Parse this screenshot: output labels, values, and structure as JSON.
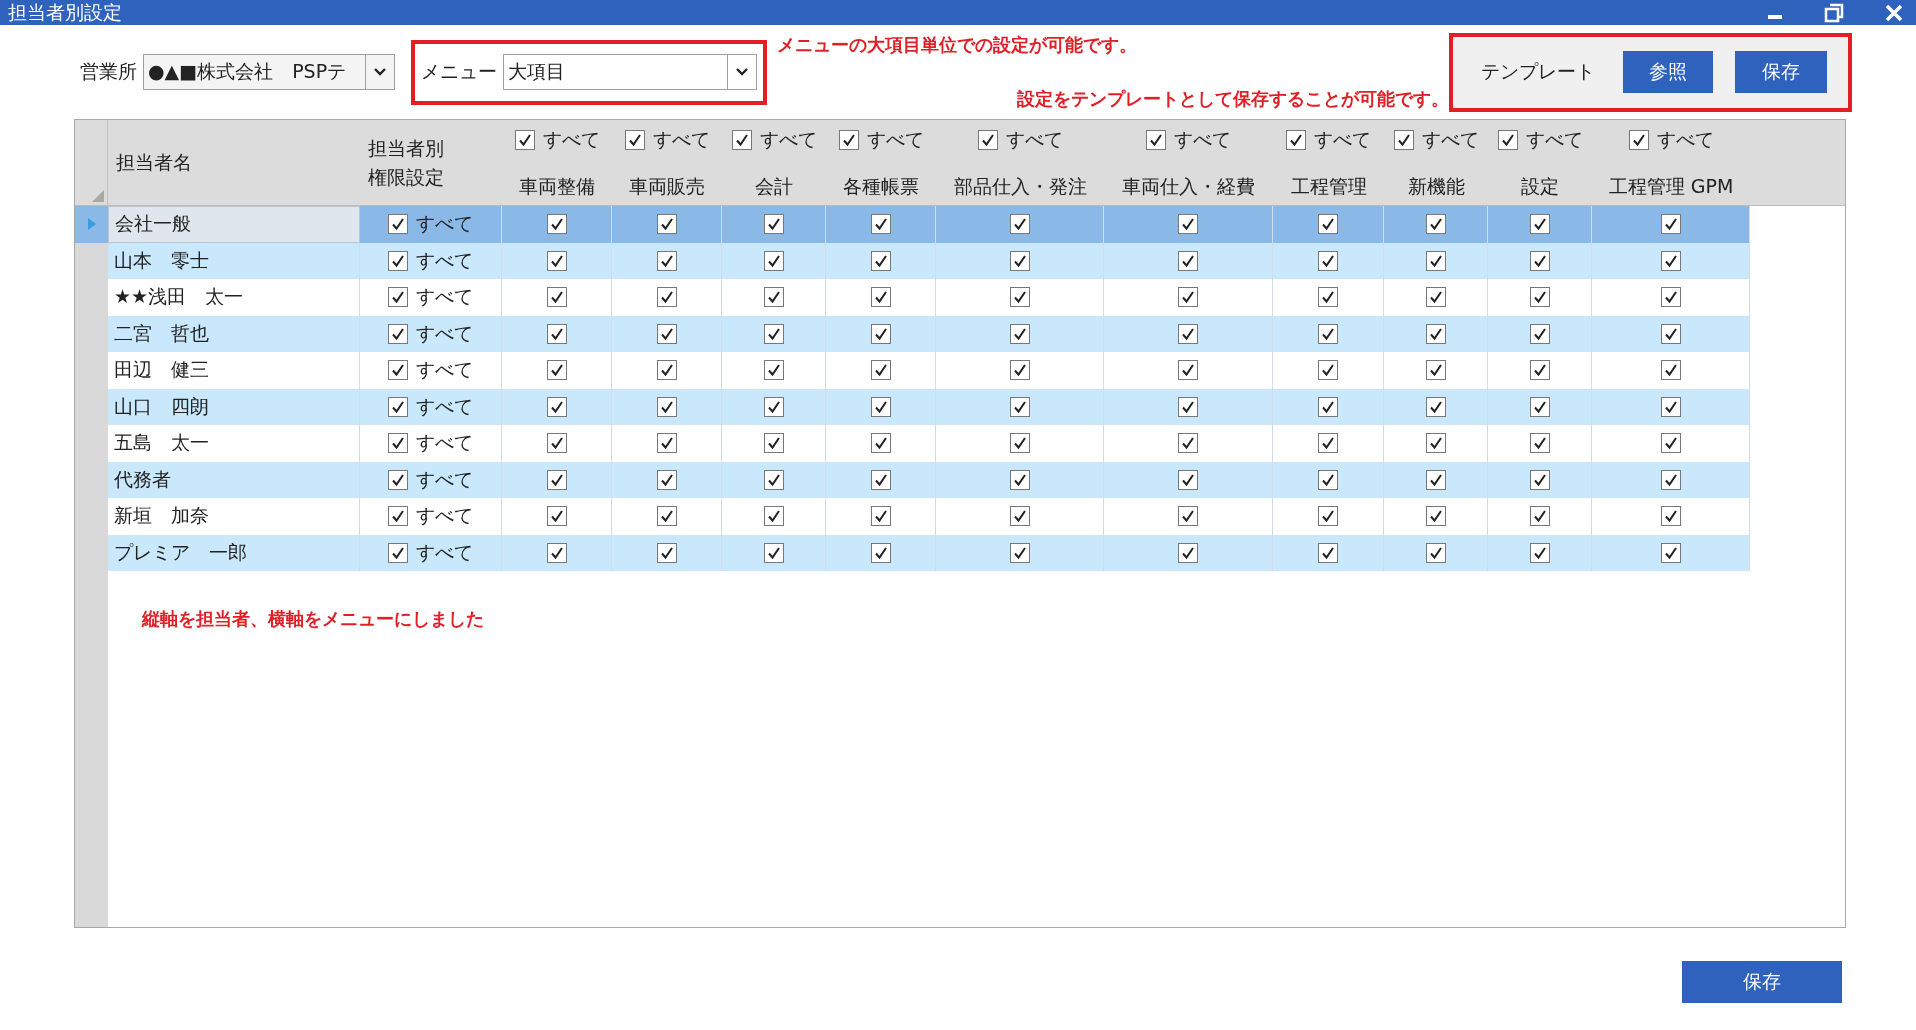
{
  "window": {
    "title": "担当者別設定"
  },
  "office": {
    "label": "営業所",
    "value": "●▲■株式会社　PSPテ"
  },
  "menu": {
    "label": "メニュー",
    "value": "大項目"
  },
  "notes": {
    "menu_note": "メニューの大項目単位での設定が可能です。",
    "template_note": "設定をテンプレートとして保存することが可能です。",
    "grid_note": "縦軸を担当者、横軸をメニューにしました"
  },
  "template": {
    "label": "テンプレート",
    "buttons": [
      "参照",
      "保存"
    ]
  },
  "table": {
    "name_header": "担当者名",
    "perm_header": "担当者別権限設定",
    "columns": [
      {
        "label": "車両整備",
        "all_label": "すべて",
        "all_checked": true
      },
      {
        "label": "車両販売",
        "all_label": "すべて",
        "all_checked": true
      },
      {
        "label": "会計",
        "all_label": "すべて",
        "all_checked": true
      },
      {
        "label": "各種帳票",
        "all_label": "すべて",
        "all_checked": true
      },
      {
        "label": "部品仕入・発注",
        "all_label": "すべて",
        "all_checked": true
      },
      {
        "label": "車両仕入・経費",
        "all_label": "すべて",
        "all_checked": true
      },
      {
        "label": "工程管理",
        "all_label": "すべて",
        "all_checked": true
      },
      {
        "label": "新機能",
        "all_label": "すべて",
        "all_checked": true
      },
      {
        "label": "設定",
        "all_label": "すべて",
        "all_checked": true
      },
      {
        "label": "工程管理 GPM",
        "all_label": "すべて",
        "all_checked": true
      }
    ],
    "rows": [
      {
        "name": "会社一般",
        "selected": true,
        "all_label": "すべて",
        "all_checked": true,
        "checks": [
          true,
          true,
          true,
          true,
          true,
          true,
          true,
          true,
          true,
          true
        ]
      },
      {
        "name": "山本　零士",
        "selected": false,
        "all_label": "すべて",
        "all_checked": true,
        "checks": [
          true,
          true,
          true,
          true,
          true,
          true,
          true,
          true,
          true,
          true
        ]
      },
      {
        "name": "★★浅田　太一",
        "selected": false,
        "all_label": "すべて",
        "all_checked": true,
        "checks": [
          true,
          true,
          true,
          true,
          true,
          true,
          true,
          true,
          true,
          true
        ]
      },
      {
        "name": "二宮　哲也",
        "selected": false,
        "all_label": "すべて",
        "all_checked": true,
        "checks": [
          true,
          true,
          true,
          true,
          true,
          true,
          true,
          true,
          true,
          true
        ]
      },
      {
        "name": "田辺　健三",
        "selected": false,
        "all_label": "すべて",
        "all_checked": true,
        "checks": [
          true,
          true,
          true,
          true,
          true,
          true,
          true,
          true,
          true,
          true
        ]
      },
      {
        "name": "山口　四朗",
        "selected": false,
        "all_label": "すべて",
        "all_checked": true,
        "checks": [
          true,
          true,
          true,
          true,
          true,
          true,
          true,
          true,
          true,
          true
        ]
      },
      {
        "name": "五島　太一",
        "selected": false,
        "all_label": "すべて",
        "all_checked": true,
        "checks": [
          true,
          true,
          true,
          true,
          true,
          true,
          true,
          true,
          true,
          true
        ]
      },
      {
        "name": "代務者",
        "selected": false,
        "all_label": "すべて",
        "all_checked": true,
        "checks": [
          true,
          true,
          true,
          true,
          true,
          true,
          true,
          true,
          true,
          true
        ]
      },
      {
        "name": "新垣　加奈",
        "selected": false,
        "all_label": "すべて",
        "all_checked": true,
        "checks": [
          true,
          true,
          true,
          true,
          true,
          true,
          true,
          true,
          true,
          true
        ]
      },
      {
        "name": "プレミア　一郎",
        "selected": false,
        "all_label": "すべて",
        "all_checked": true,
        "checks": [
          true,
          true,
          true,
          true,
          true,
          true,
          true,
          true,
          true,
          true
        ]
      }
    ]
  },
  "footer": {
    "save_button": "保存"
  }
}
